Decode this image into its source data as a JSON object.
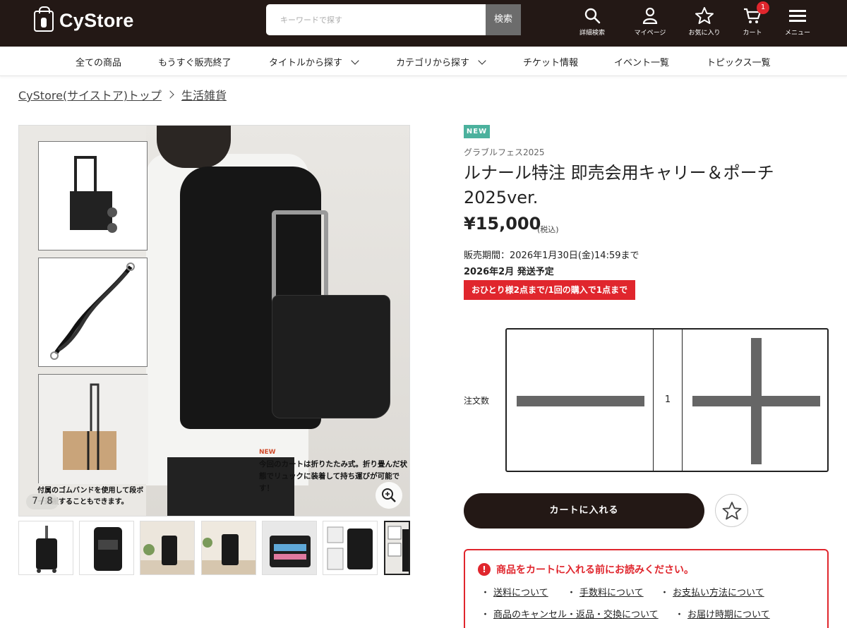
{
  "header": {
    "logo": "CyStore",
    "search_placeholder": "キーワードで探す",
    "search_button": "検索",
    "icons": [
      {
        "name": "search-icon",
        "label": "詳細検索"
      },
      {
        "name": "user-icon",
        "label": "マイページ"
      },
      {
        "name": "star-icon",
        "label": "お気に入り"
      },
      {
        "name": "cart-icon",
        "label": "カート"
      },
      {
        "name": "menu-icon",
        "label": "メニュー"
      }
    ],
    "cart_count": "1"
  },
  "nav": {
    "items": [
      "全ての商品",
      "もうすぐ販売終了",
      "タイトルから探す",
      "カテゴリから探す",
      "チケット情報",
      "イベント一覧",
      "トピックス一覧"
    ]
  },
  "breadcrumb": [
    "CyStore(サイストア)トップ",
    "生活雑貨"
  ],
  "gallery": {
    "counter": "7 / 8",
    "caption_new": "NEW",
    "caption_main": "今回のカートは折りたたみ式。折り畳んだ状態でリュックに装着して持ち運びが可能です！",
    "caption_side": "付属のゴムバンドを使用して段ボー運搬することもできます。"
  },
  "product": {
    "badge": "NEW",
    "series": "グラブルフェス2025",
    "title": "ルナール特注 即売会用キャリー＆ポーチ 2025ver.",
    "price": "¥15,000",
    "tax": "(税込)",
    "period": "販売期間：2026年1月30日(金)14:59まで",
    "shipping": "2026年2月 発送予定",
    "limit": "おひとり様2点まで/1回の購入で1点まで"
  },
  "order": {
    "qty_label": "注文数",
    "qty_value": "1",
    "cart_button": "カートに入れる"
  },
  "notice": {
    "heading": "商品をカートに入れる前にお読みください。",
    "links": [
      "送料について",
      "手数料について",
      "お支払い方法について",
      "商品のキャンセル・返品・交換について",
      "お届け時期について"
    ]
  },
  "colors": {
    "header_bg": "#231815",
    "accent_red": "#e0262d",
    "new_badge": "#4bb19d"
  }
}
